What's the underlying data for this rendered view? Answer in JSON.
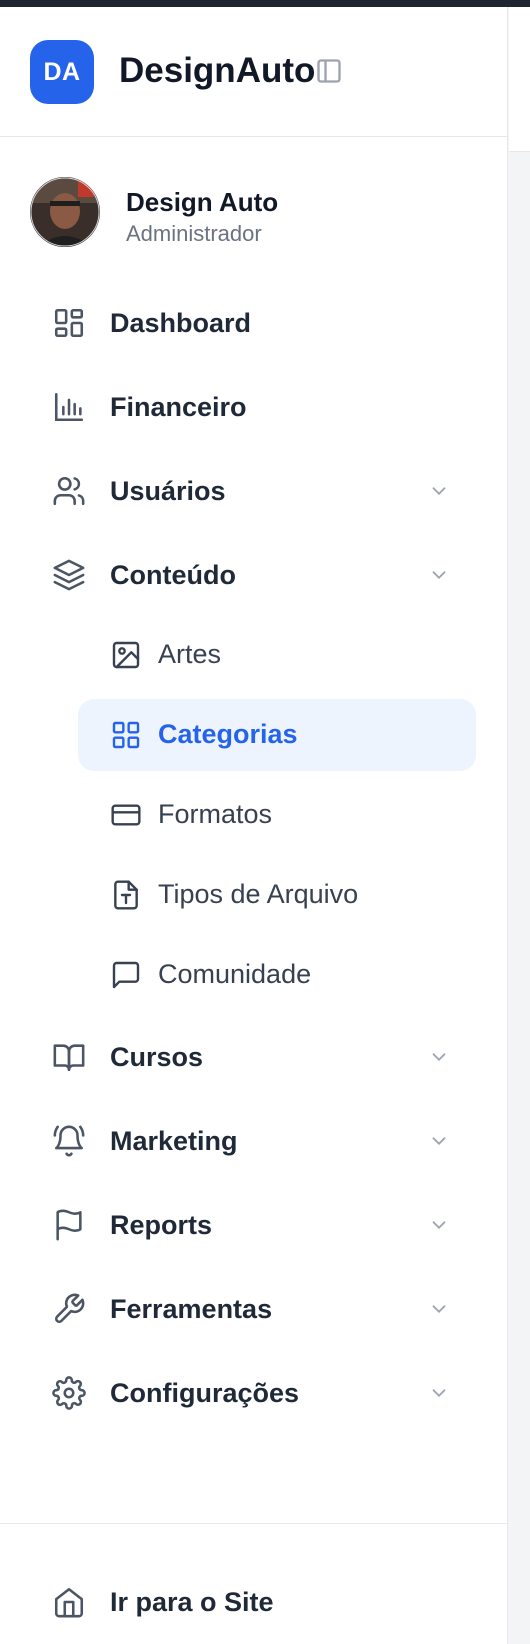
{
  "brand": {
    "logo_text": "DA",
    "name": "DesignAuto"
  },
  "user": {
    "name": "Design Auto",
    "role": "Administrador"
  },
  "nav": {
    "dashboard": "Dashboard",
    "financeiro": "Financeiro",
    "usuarios": "Usuários",
    "conteudo": "Conteúdo",
    "cursos": "Cursos",
    "marketing": "Marketing",
    "reports": "Reports",
    "ferramentas": "Ferramentas",
    "configuracoes": "Configurações"
  },
  "conteudo_sub": {
    "artes": "Artes",
    "categorias": "Categorias",
    "formatos": "Formatos",
    "tipos_arquivo": "Tipos de Arquivo",
    "comunidade": "Comunidade"
  },
  "footer": {
    "site_link": "Ir para o Site"
  },
  "colors": {
    "accent": "#2563eb",
    "active_bg": "#eef4fd",
    "text": "#1f2937",
    "muted": "#6b7280"
  },
  "icons": {
    "dashboard": "layout-grid-icon",
    "financeiro": "bar-chart-icon",
    "usuarios": "users-icon",
    "conteudo": "layers-icon",
    "artes": "image-icon",
    "categorias": "grid-icon",
    "formatos": "credit-card-icon",
    "tipos_arquivo": "file-type-icon",
    "comunidade": "message-square-icon",
    "cursos": "book-open-icon",
    "marketing": "bell-ring-icon",
    "reports": "flag-icon",
    "ferramentas": "wrench-icon",
    "configuracoes": "settings-icon",
    "site": "home-icon"
  }
}
